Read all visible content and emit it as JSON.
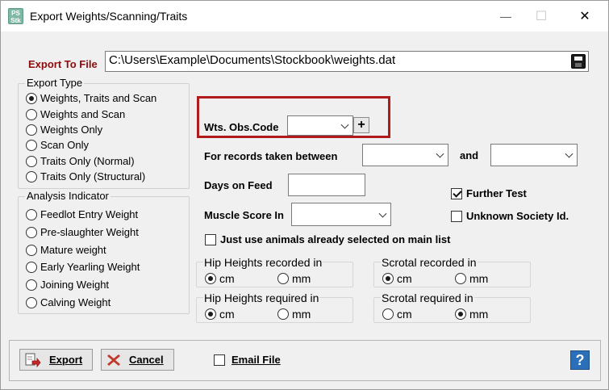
{
  "window": {
    "title": "Export Weights/Scanning/Traits",
    "app_icon_text": [
      "PS",
      "Stk"
    ],
    "minimize_glyph": "—",
    "maximize_glyph": "☐",
    "close_glyph": "✕"
  },
  "export_file": {
    "label": "Export To File",
    "value": "C:\\Users\\Example\\Documents\\Stockbook\\weights.dat",
    "save_icon": "floppy-disk-icon"
  },
  "export_type": {
    "title": "Export Type",
    "options": [
      {
        "label": "Weights, Traits and Scan",
        "selected": true
      },
      {
        "label": "Weights and Scan",
        "selected": false
      },
      {
        "label": "Weights Only",
        "selected": false
      },
      {
        "label": "Scan Only",
        "selected": false
      },
      {
        "label": "Traits Only (Normal)",
        "selected": false
      },
      {
        "label": "Traits Only (Structural)",
        "selected": false
      }
    ]
  },
  "analysis_indicator": {
    "title": "Analysis Indicator",
    "options": [
      {
        "label": "Feedlot Entry Weight",
        "selected": false
      },
      {
        "label": "Pre-slaughter Weight",
        "selected": false
      },
      {
        "label": "Mature weight",
        "selected": false
      },
      {
        "label": "Early Yearling Weight",
        "selected": false
      },
      {
        "label": "Joining Weight",
        "selected": false
      },
      {
        "label": "Calving Weight",
        "selected": false
      }
    ]
  },
  "wts_obs_code": {
    "label": "Wts. Obs.Code",
    "value": "",
    "add_label": "+"
  },
  "records_between": {
    "label": "For records taken between",
    "from_value": "",
    "and_label": "and",
    "to_value": ""
  },
  "days_on_feed": {
    "label": "Days on Feed",
    "value": ""
  },
  "muscle_score": {
    "label": "Muscle Score In",
    "value": ""
  },
  "further_test": {
    "label": "Further Test",
    "checked": true
  },
  "unknown_society": {
    "label": "Unknown Society Id.",
    "checked": false
  },
  "just_use_selected": {
    "label": "Just use animals already selected on main list",
    "checked": false
  },
  "hip_recorded": {
    "title": "Hip Heights recorded in",
    "cm": "cm",
    "mm": "mm",
    "selected": "cm"
  },
  "hip_required": {
    "title": "Hip Heights required in",
    "cm": "cm",
    "mm": "mm",
    "selected": "cm"
  },
  "scrotal_recorded": {
    "title": "Scrotal recorded in",
    "cm": "cm",
    "mm": "mm",
    "selected": "cm"
  },
  "scrotal_required": {
    "title": "Scrotal required in",
    "cm": "cm",
    "mm": "mm",
    "selected": "mm"
  },
  "footer": {
    "export_label": "Export",
    "cancel_label": "Cancel",
    "email_label": "Email File",
    "email_checked": false,
    "help_glyph": "?"
  },
  "colors": {
    "highlight": "#b01b1b",
    "label_red": "#8b0c0c",
    "cancel_x": "#c0392b"
  }
}
